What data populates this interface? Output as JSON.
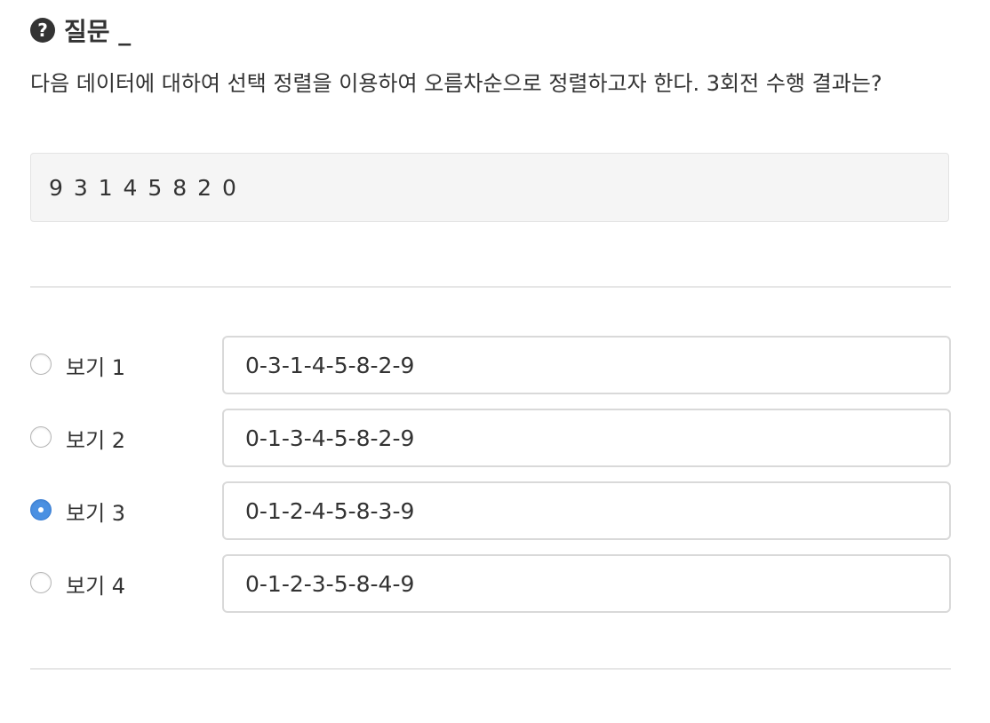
{
  "header": {
    "icon": "question-circle-icon",
    "title": "질문 _"
  },
  "question": {
    "text": "다음 데이터에 대하여 선택 정렬을 이용하여 오름차순으로 정렬하고자 한다. 3회전 수행 결과는?"
  },
  "data_box": {
    "value": "9 3 1 4 5 8 2 0"
  },
  "options": [
    {
      "label": "보기 1",
      "value": "0-3-1-4-5-8-2-9",
      "selected": false
    },
    {
      "label": "보기 2",
      "value": "0-1-3-4-5-8-2-9",
      "selected": false
    },
    {
      "label": "보기 3",
      "value": "0-1-2-4-5-8-3-9",
      "selected": true
    },
    {
      "label": "보기 4",
      "value": "0-1-2-3-5-8-4-9",
      "selected": false
    }
  ],
  "colors": {
    "accent": "#4a90e2",
    "text": "#333333",
    "data_box_bg": "#f5f5f5"
  }
}
